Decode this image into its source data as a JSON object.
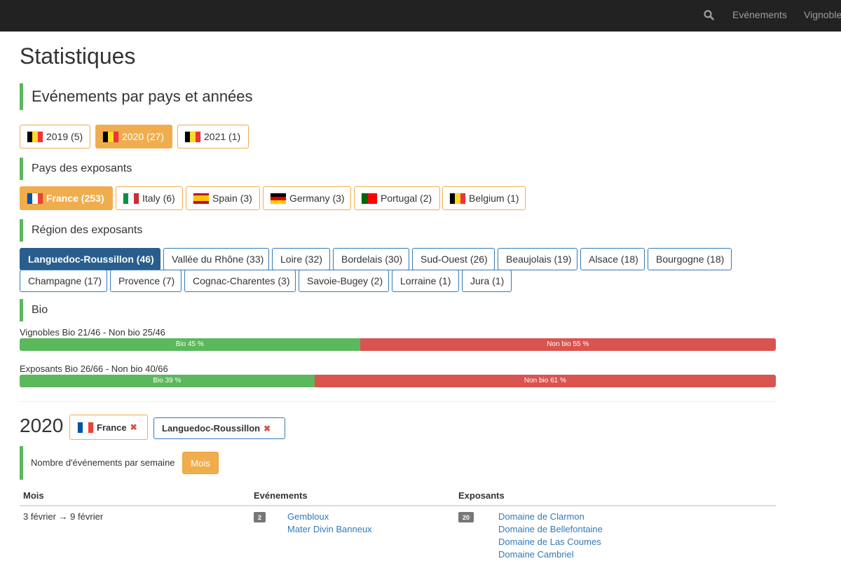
{
  "nav": {
    "links": [
      "Evénements",
      "Vignobles"
    ]
  },
  "page": {
    "title": "Statistiques"
  },
  "events_section": {
    "title": "Evénements par pays et années",
    "years": [
      {
        "label": "2019 (5)",
        "flag": "belgium-flag",
        "active": false
      },
      {
        "label": "2020 (27)",
        "flag": "belgium-flag",
        "active": true
      },
      {
        "label": "2021 (1)",
        "flag": "belgium-flag",
        "active": false
      }
    ]
  },
  "countries_section": {
    "title": "Pays des exposants",
    "countries": [
      {
        "label": "France (253)",
        "flag": "france-flag",
        "active": true
      },
      {
        "label": "Italy (6)",
        "flag": "italy-flag",
        "active": false
      },
      {
        "label": "Spain (3)",
        "flag": "spain-flag",
        "active": false
      },
      {
        "label": "Germany (3)",
        "flag": "germany-flag",
        "active": false
      },
      {
        "label": "Portugal (2)",
        "flag": "portugal-flag",
        "active": false
      },
      {
        "label": "Belgium (1)",
        "flag": "belgium-flag",
        "active": false
      }
    ]
  },
  "regions_section": {
    "title": "Région des exposants",
    "regions": [
      "Languedoc-Roussillon (46)",
      "Vallée du Rhône (33)",
      "Loire (32)",
      "Bordelais (30)",
      "Sud-Ouest (26)",
      "Beaujolais (19)",
      "Alsace (18)",
      "Bourgogne (18)",
      "Champagne (17)",
      "Provence (7)",
      "Cognac-Charentes (3)",
      "Savoie-Bugey (2)",
      "Lorraine (1)",
      "Jura (1)"
    ],
    "active_index": 0
  },
  "bio_section": {
    "title": "Bio",
    "vignobles": {
      "label": "Vignobles Bio 21/46 - Non bio 25/46",
      "bio_text": "Bio 45 %",
      "nonbio_text": "Non bio 55 %",
      "bio_percent": 45
    },
    "exposants": {
      "label": "Exposants Bio 26/66 - Non bio 40/66",
      "bio_text": "Bio 39 %",
      "nonbio_text": "Non bio 61 %",
      "bio_percent": 39
    }
  },
  "filter": {
    "year": "2020",
    "tags": [
      {
        "label": "France",
        "flag": "france-flag"
      },
      {
        "label": "Languedoc-Roussillon"
      }
    ],
    "remove_glyph": "✖"
  },
  "weekly": {
    "text": "Nombre d'événements par semaine",
    "button": "Mois"
  },
  "table": {
    "headers": [
      "Mois",
      "Evénements",
      "Exposants"
    ],
    "rows": [
      {
        "period": "3 février → 9 février",
        "events_count": "2",
        "events": [
          "Gembloux",
          "Mater Divin Banneux"
        ],
        "exhibitors_count": "20",
        "exhibitors": [
          "Domaine de Clarmon",
          "Domaine de Bellefontaine",
          "Domaine de Las Coumes",
          "Domaine Cambriel"
        ]
      }
    ]
  },
  "colors": {
    "accent_orange": "#f0ad4e",
    "accent_green": "#5cb85c",
    "danger_red": "#d9534f",
    "primary_blue": "#337ab7"
  },
  "icons": {
    "search": "search-icon",
    "remove": "remove-icon"
  }
}
